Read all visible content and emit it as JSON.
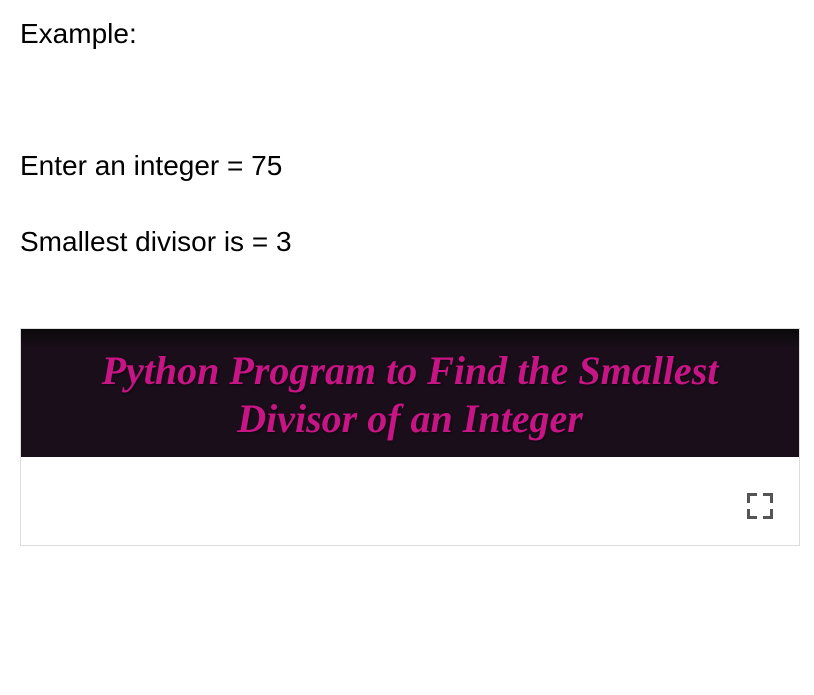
{
  "example_heading": "Example:",
  "input_line": "Enter an integer = 75",
  "output_line": "Smallest divisor is = 3",
  "video": {
    "title": "Python Program to Find the Smallest Divisor of an Integer"
  }
}
